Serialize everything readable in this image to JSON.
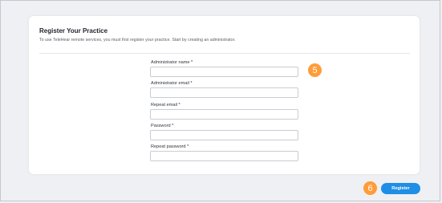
{
  "header": {
    "title": "Register Your Practice",
    "subtitle": "To use TeleHear remote services, you must first register your practice. Start by creating an administrator."
  },
  "form": {
    "fields": [
      {
        "label": "Administrator name *",
        "value": ""
      },
      {
        "label": "Administrator email *",
        "value": ""
      },
      {
        "label": "Repeat email *",
        "value": ""
      },
      {
        "label": "Password *",
        "value": ""
      },
      {
        "label": "Repeat password *",
        "value": ""
      }
    ]
  },
  "annotations": {
    "step5": "5",
    "step6": "6"
  },
  "actions": {
    "register_label": "Register"
  },
  "colors": {
    "accent": "#1f8ee6",
    "badge": "#ff9c38",
    "background": "#eef0f3"
  }
}
